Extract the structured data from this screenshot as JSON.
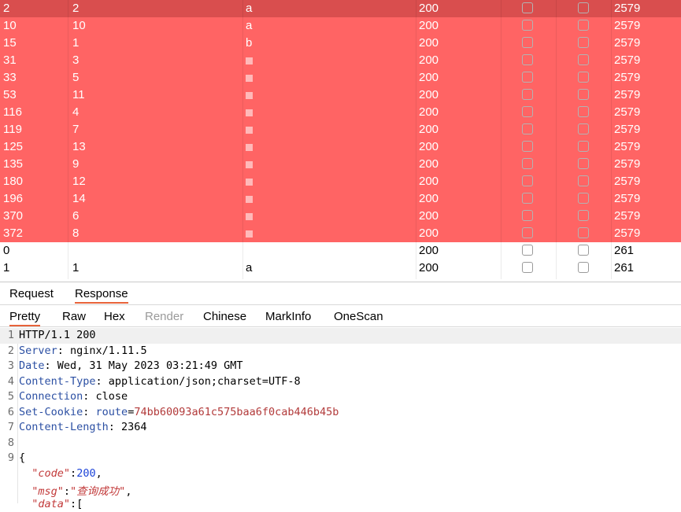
{
  "table": {
    "rows": [
      {
        "request": "2",
        "payload": "2",
        "payload_text": "a",
        "status": "200",
        "length": "2579",
        "style": "sel"
      },
      {
        "request": "10",
        "payload": "10",
        "payload_text": "a",
        "status": "200",
        "length": "2579",
        "style": "hl"
      },
      {
        "request": "15",
        "payload": "1",
        "payload_text": "b",
        "status": "200",
        "length": "2579",
        "style": "hl"
      },
      {
        "request": "31",
        "payload": "3",
        "payload_text": "",
        "status": "200",
        "length": "2579",
        "style": "hl"
      },
      {
        "request": "33",
        "payload": "5",
        "payload_text": "",
        "status": "200",
        "length": "2579",
        "style": "hl"
      },
      {
        "request": "53",
        "payload": "11",
        "payload_text": "",
        "status": "200",
        "length": "2579",
        "style": "hl"
      },
      {
        "request": "116",
        "payload": "4",
        "payload_text": "",
        "status": "200",
        "length": "2579",
        "style": "hl"
      },
      {
        "request": "119",
        "payload": "7",
        "payload_text": "",
        "status": "200",
        "length": "2579",
        "style": "hl"
      },
      {
        "request": "125",
        "payload": "13",
        "payload_text": "",
        "status": "200",
        "length": "2579",
        "style": "hl"
      },
      {
        "request": "135",
        "payload": "9",
        "payload_text": "",
        "status": "200",
        "length": "2579",
        "style": "hl"
      },
      {
        "request": "180",
        "payload": "12",
        "payload_text": "",
        "status": "200",
        "length": "2579",
        "style": "hl"
      },
      {
        "request": "196",
        "payload": "14",
        "payload_text": "",
        "status": "200",
        "length": "2579",
        "style": "hl"
      },
      {
        "request": "370",
        "payload": "6",
        "payload_text": "",
        "status": "200",
        "length": "2579",
        "style": "hl"
      },
      {
        "request": "372",
        "payload": "8",
        "payload_text": "",
        "status": "200",
        "length": "2579",
        "style": "hl"
      },
      {
        "request": "0",
        "payload": "",
        "payload_text": "",
        "status": "200",
        "length": "261",
        "style": "plain"
      },
      {
        "request": "1",
        "payload": "1",
        "payload_text": "a",
        "status": "200",
        "length": "261",
        "style": "plain"
      }
    ]
  },
  "tabs": {
    "request": "Request",
    "response": "Response"
  },
  "subtabs": {
    "pretty": "Pretty",
    "raw": "Raw",
    "hex": "Hex",
    "render": "Render",
    "chinese": "Chinese",
    "markinfo": "MarkInfo",
    "onescan": "OneScan"
  },
  "response": {
    "lines": [
      {
        "num": "1",
        "parts": [
          [
            "HTTP/1.1 200",
            ""
          ]
        ]
      },
      {
        "num": "2",
        "parts": [
          [
            "Server",
            ""
          ],
          [
            ": nginx/1.11.5",
            ""
          ]
        ]
      },
      {
        "num": "3",
        "parts": [
          [
            "Date",
            ""
          ],
          [
            ": Wed, 31 May 2023 03:21:49 GMT",
            ""
          ]
        ]
      },
      {
        "num": "4",
        "parts": [
          [
            "Content-Type",
            ""
          ],
          [
            ": application/json;charset=UTF-8",
            ""
          ]
        ]
      },
      {
        "num": "5",
        "parts": [
          [
            "Connection",
            ""
          ],
          [
            ": close",
            ""
          ]
        ]
      },
      {
        "num": "6",
        "parts": [
          [
            "Set-Cookie",
            ""
          ],
          [
            ": ",
            ""
          ],
          [
            "route",
            ""
          ],
          [
            "=",
            ""
          ],
          [
            "74bb60093a61c575baa6f0cab446b45b",
            ""
          ]
        ]
      },
      {
        "num": "7",
        "parts": [
          [
            "Content-Length",
            ""
          ],
          [
            ": 2364",
            ""
          ]
        ]
      },
      {
        "num": "8",
        "parts": [
          [
            "",
            ""
          ]
        ]
      },
      {
        "num": "9",
        "parts": [
          [
            "{",
            ""
          ]
        ]
      },
      {
        "num": "",
        "parts": [
          [
            "  ",
            ""
          ],
          [
            "\"code\"",
            ""
          ],
          [
            ":",
            ""
          ],
          [
            "200",
            ""
          ],
          [
            ",",
            ""
          ]
        ]
      },
      {
        "num": "",
        "parts": [
          [
            "  ",
            ""
          ],
          [
            "\"msg\"",
            ""
          ],
          [
            ":",
            ""
          ],
          [
            "\"查询成功\"",
            ""
          ],
          [
            ",",
            ""
          ]
        ]
      },
      {
        "num": "",
        "parts": [
          [
            "  ",
            ""
          ],
          [
            "\"data\"",
            ""
          ],
          [
            ":[",
            ""
          ]
        ]
      }
    ]
  },
  "colors": {
    "highlight_row": "#ff6464",
    "selected_row": "#d94e4e",
    "tab_accent": "#e8633a",
    "header_name": "#2b4fa3",
    "cookie_value": "#b23a3a",
    "json_key": "#c23a3a",
    "json_number": "#1d44d8"
  }
}
